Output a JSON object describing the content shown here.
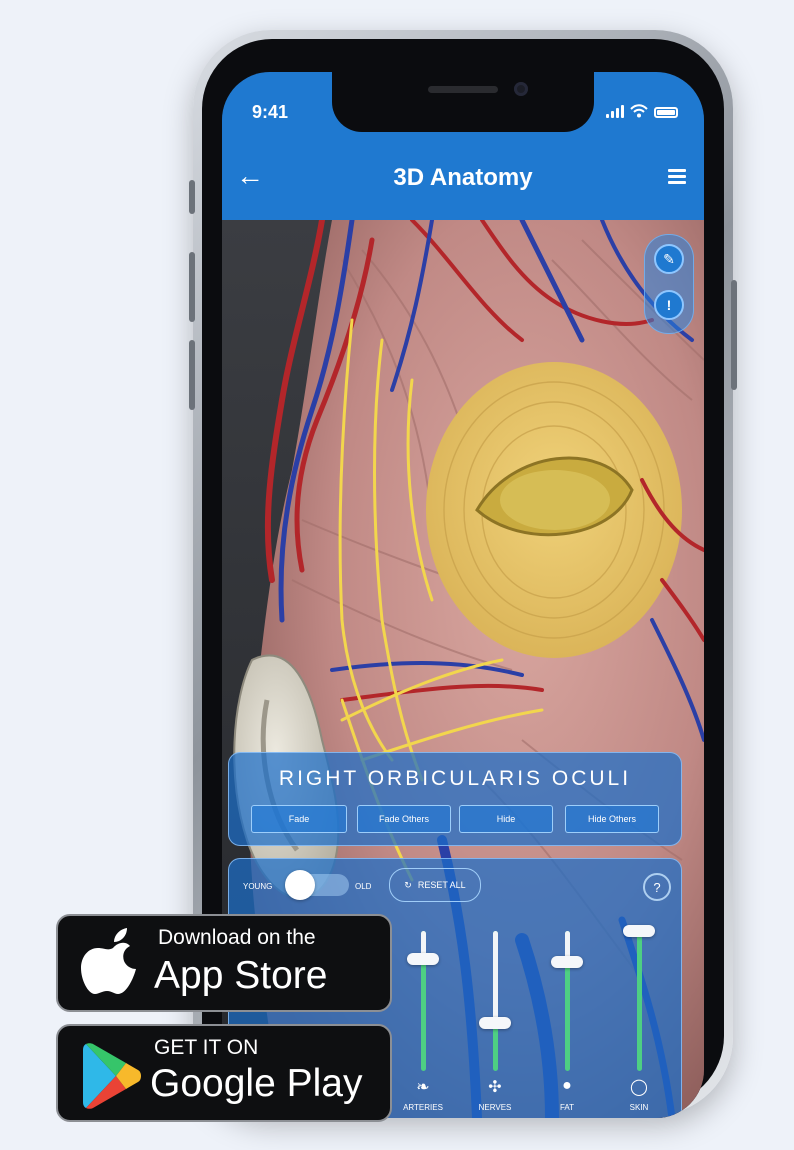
{
  "status_bar": {
    "time": "9:41"
  },
  "header": {
    "title": "3D Anatomy",
    "back_icon": "back-arrow-icon",
    "menu_icon": "hamburger-menu-icon"
  },
  "floating_tools": {
    "top_icon": "edit-pen-icon",
    "bottom_icon": "warning-triangle-icon"
  },
  "selection_panel": {
    "structure_name": "RIGHT ORBICULARIS OCULI",
    "actions": [
      "Fade",
      "Fade Others",
      "Hide",
      "Hide Others"
    ]
  },
  "layers_panel": {
    "age_toggle": {
      "left_label": "YOUNG",
      "right_label": "OLD",
      "value": "YOUNG"
    },
    "reset_label": "RESET ALL",
    "help_icon": "help-icon",
    "layers": [
      {
        "label": "ARTERIES",
        "icon": "arteries-icon",
        "level": 0.8
      },
      {
        "label": "NERVES",
        "icon": "nerves-icon",
        "level": 0.34
      },
      {
        "label": "FAT",
        "icon": "fat-icon",
        "level": 0.78
      },
      {
        "label": "SKIN",
        "icon": "skin-icon",
        "level": 1.0
      }
    ]
  },
  "colors": {
    "accent": "#1f79d0",
    "slider_fill": "#4ecf83",
    "muscle_highlight": "#e9c566"
  },
  "store_badges": {
    "app_store": {
      "line1": "Download on the",
      "line2": "App Store",
      "icon": "apple-logo-icon"
    },
    "google_play": {
      "line1": "GET IT ON",
      "line2": "Google Play",
      "icon": "google-play-logo-icon"
    }
  }
}
